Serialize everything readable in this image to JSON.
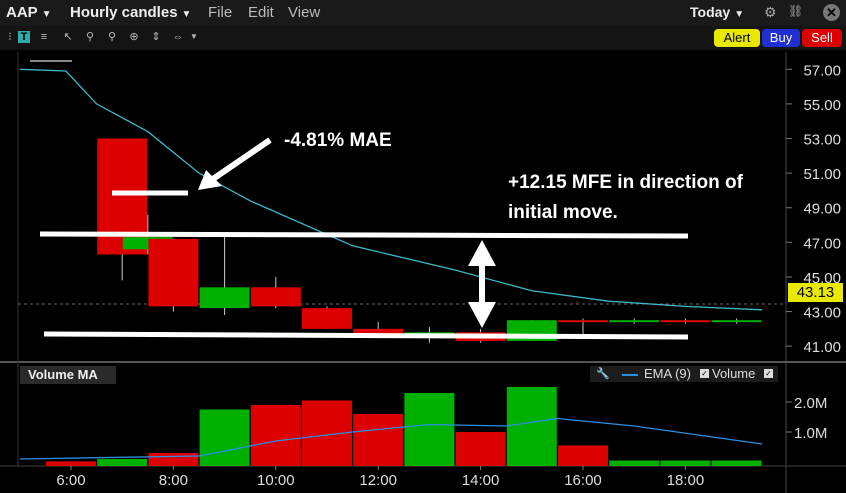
{
  "header": {
    "symbol": "AAP",
    "chart_type": "Hourly candles",
    "menu": [
      "File",
      "Edit",
      "View"
    ],
    "period": "Today"
  },
  "actions": {
    "alert": "Alert",
    "buy": "Buy",
    "sell": "Sell"
  },
  "icons": [
    "text-icon",
    "list-icon",
    "cursor-icon",
    "zoom-icon",
    "zoom-out-icon",
    "crosshair-icon",
    "split-horizontal-icon",
    "split-vertical-icon",
    "gear-icon",
    "link-icon",
    "close-icon"
  ],
  "volume_panel": {
    "title": "Volume MA",
    "legend_ema": "EMA (9)",
    "legend_volume": "Volume"
  },
  "annotations": {
    "mae": "-4.81% MAE",
    "mfe_line1": "+12.15 MFE in direction of",
    "mfe_line2": "initial move."
  },
  "last_price": "43.13",
  "colors": {
    "up": "#00b000",
    "down": "#dd0000",
    "ema": "#3fb8c8",
    "vol_ema": "#2a8fe0",
    "price_tag": "#e8e800",
    "alert": "#e8e800",
    "buy": "#2030d0",
    "sell": "#dd0000"
  },
  "chart_data": {
    "type": "candlestick",
    "x_ticks": [
      "6:00",
      "8:00",
      "10:00",
      "12:00",
      "14:00",
      "16:00",
      "18:00"
    ],
    "y_ticks": [
      "57.00",
      "55.00",
      "53.00",
      "51.00",
      "49.00",
      "47.00",
      "45.00",
      "43.00",
      "41.00"
    ],
    "ylim": [
      40.2,
      58
    ],
    "candles": [
      {
        "time": 7,
        "open": 53,
        "close": 46.3,
        "high": 53,
        "low": 44.8
      },
      {
        "time": 7.5,
        "open": 46.6,
        "close": 47.3,
        "high": 48.6,
        "low": 46.3
      },
      {
        "time": 8,
        "open": 47.2,
        "close": 43.3,
        "high": 47.2,
        "low": 43
      },
      {
        "time": 9,
        "open": 43.2,
        "close": 44.4,
        "high": 47.4,
        "low": 42.8
      },
      {
        "time": 10,
        "open": 44.4,
        "close": 43.3,
        "high": 45,
        "low": 43.2
      },
      {
        "time": 11,
        "open": 43.2,
        "close": 42,
        "high": 43.3,
        "low": 42
      },
      {
        "time": 12,
        "open": 42,
        "close": 41.6,
        "high": 42.4,
        "low": 41.5
      },
      {
        "time": 13,
        "open": 41.6,
        "close": 41.8,
        "high": 42.1,
        "low": 41.2
      },
      {
        "time": 14,
        "open": 41.8,
        "close": 41.3,
        "high": 42,
        "low": 41.2
      },
      {
        "time": 15,
        "open": 41.3,
        "close": 42.5,
        "high": 42.5,
        "low": 41.3
      },
      {
        "time": 16,
        "open": 42.5,
        "close": 42.4,
        "high": 42.6,
        "low": 41.5
      },
      {
        "time": 17,
        "open": 42.4,
        "close": 42.5,
        "high": 42.6,
        "low": 42.3
      },
      {
        "time": 18,
        "open": 42.5,
        "close": 42.4,
        "high": 42.6,
        "low": 42.3
      },
      {
        "time": 19,
        "open": 42.4,
        "close": 42.5,
        "high": 42.6,
        "low": 42.3
      }
    ],
    "ema": [
      {
        "time": 5,
        "value": 57
      },
      {
        "time": 5.9,
        "value": 56.9
      },
      {
        "time": 6.5,
        "value": 55
      },
      {
        "time": 7.5,
        "value": 53.4
      },
      {
        "time": 8.5,
        "value": 51
      },
      {
        "time": 9.5,
        "value": 49.4
      },
      {
        "time": 11.5,
        "value": 46.8
      },
      {
        "time": 13.5,
        "value": 45.4
      },
      {
        "time": 15,
        "value": 44.2
      },
      {
        "time": 16.5,
        "value": 43.6
      },
      {
        "time": 18,
        "value": 43.3
      },
      {
        "time": 19.5,
        "value": 43.1
      }
    ],
    "volume": {
      "y_ticks": [
        "2.0M",
        "1.0M"
      ],
      "ylim": [
        0,
        2.6
      ],
      "bars": [
        {
          "time": 6,
          "value": 0.02,
          "dir": "down"
        },
        {
          "time": 7,
          "value": 0.1,
          "dir": "up"
        },
        {
          "time": 8,
          "value": 0.3,
          "dir": "down"
        },
        {
          "time": 9,
          "value": 1.75,
          "dir": "up"
        },
        {
          "time": 10,
          "value": 1.9,
          "dir": "down"
        },
        {
          "time": 11,
          "value": 2.05,
          "dir": "down"
        },
        {
          "time": 12,
          "value": 1.6,
          "dir": "down"
        },
        {
          "time": 13,
          "value": 2.3,
          "dir": "up"
        },
        {
          "time": 14,
          "value": 1.0,
          "dir": "down"
        },
        {
          "time": 15,
          "value": 2.5,
          "dir": "up"
        },
        {
          "time": 16,
          "value": 0.55,
          "dir": "down"
        },
        {
          "time": 17,
          "value": 0.05,
          "dir": "up"
        },
        {
          "time": 18,
          "value": 0.05,
          "dir": "up"
        },
        {
          "time": 19,
          "value": 0.05,
          "dir": "up"
        }
      ],
      "ema": [
        {
          "time": 5,
          "value": 0.1
        },
        {
          "time": 8.5,
          "value": 0.2
        },
        {
          "time": 10,
          "value": 0.7
        },
        {
          "time": 11.5,
          "value": 1.0
        },
        {
          "time": 13,
          "value": 1.25
        },
        {
          "time": 14.5,
          "value": 1.2
        },
        {
          "time": 15.5,
          "value": 1.45
        },
        {
          "time": 17,
          "value": 1.2
        },
        {
          "time": 19.5,
          "value": 0.6
        }
      ]
    }
  }
}
